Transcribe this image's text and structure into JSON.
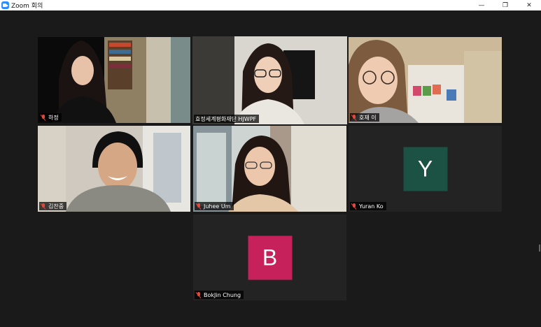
{
  "window": {
    "title": "Zoom 회의",
    "controls": {
      "minimize": "—",
      "restore": "❐",
      "close": "✕"
    }
  },
  "colors": {
    "background": "#1a1a1a",
    "active_speaker": "#b3d334",
    "muted_mic": "#e0483e",
    "avatar_y": "#1b5243",
    "avatar_b": "#c6215a"
  },
  "participants": [
    {
      "name": "하정",
      "muted": true,
      "video": true
    },
    {
      "name": "효정세계평화재단 HJWPF",
      "muted": false,
      "video": true,
      "active_speaker": true
    },
    {
      "name": "호재 이",
      "muted": true,
      "video": true
    },
    {
      "name": "김찬중",
      "muted": true,
      "video": true
    },
    {
      "name": "Juhee Um",
      "muted": true,
      "video": true
    },
    {
      "name": "Yuran Ko",
      "muted": true,
      "video": false,
      "avatar_letter": "Y"
    },
    {
      "name": "BokJin Chung",
      "muted": true,
      "video": false,
      "avatar_letter": "B"
    }
  ]
}
